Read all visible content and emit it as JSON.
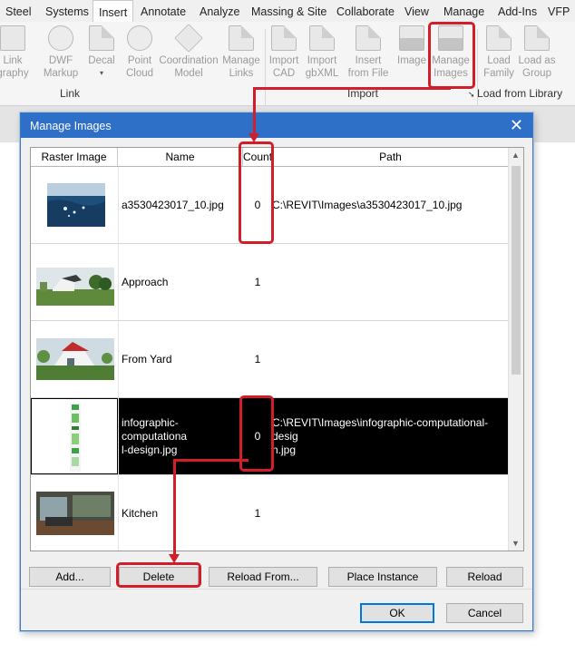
{
  "ribbon": {
    "tabs": [
      "Steel",
      "Systems",
      "Insert",
      "Annotate",
      "Analyze",
      "Massing & Site",
      "Collaborate",
      "View",
      "Manage",
      "Add-Ins",
      "VFP"
    ],
    "active_tab": "Insert",
    "buttons": [
      {
        "l1": "Link",
        "l2": "graphy"
      },
      {
        "l1": "DWF",
        "l2": "Markup"
      },
      {
        "l1": "Decal",
        "l2": "▾"
      },
      {
        "l1": "Point",
        "l2": "Cloud"
      },
      {
        "l1": "Coordination",
        "l2": "Model"
      },
      {
        "l1": "Manage",
        "l2": "Links"
      },
      {
        "l1": "Import",
        "l2": "CAD"
      },
      {
        "l1": "Import",
        "l2": "gbXML"
      },
      {
        "l1": "Insert",
        "l2": "from File"
      },
      {
        "l1": "Image",
        "l2": ""
      },
      {
        "l1": "Manage",
        "l2": "Images"
      },
      {
        "l1": "Load",
        "l2": "Family"
      },
      {
        "l1": "Load as",
        "l2": "Group"
      }
    ],
    "groups": {
      "link": "Link",
      "import": "Import",
      "load_from_library": "Load from Library"
    }
  },
  "dialog": {
    "title": "Manage Images",
    "columns": {
      "raster": "Raster Image",
      "name": "Name",
      "count": "Count",
      "path": "Path"
    },
    "rows": [
      {
        "name": "a3530423017_10.jpg",
        "count": "0",
        "path": "C:\\REVIT\\Images\\a3530423017_10.jpg",
        "selected": false
      },
      {
        "name": "Approach",
        "count": "1",
        "path": "",
        "selected": false
      },
      {
        "name": "From Yard",
        "count": "1",
        "path": "",
        "selected": false
      },
      {
        "name": "infographic-computational-design.jpg",
        "name_l1": "infographic-computationa",
        "name_l2": "l-design.jpg",
        "count": "0",
        "path": "C:\\REVIT\\Images\\infographic-computational-design.jpg",
        "path_l1": "C:\\REVIT\\Images\\infographic-computational-desig",
        "path_l2": "n.jpg",
        "selected": true
      },
      {
        "name": "Kitchen",
        "count": "1",
        "path": "",
        "selected": false
      }
    ],
    "buttons": {
      "add": "Add...",
      "delete": "Delete",
      "reload_from": "Reload From...",
      "place_instance": "Place Instance",
      "reload": "Reload",
      "ok": "OK",
      "cancel": "Cancel"
    }
  },
  "colors": {
    "title_bar": "#2e6fc8",
    "selection": "#000000",
    "annotation": "#d11f2a"
  }
}
